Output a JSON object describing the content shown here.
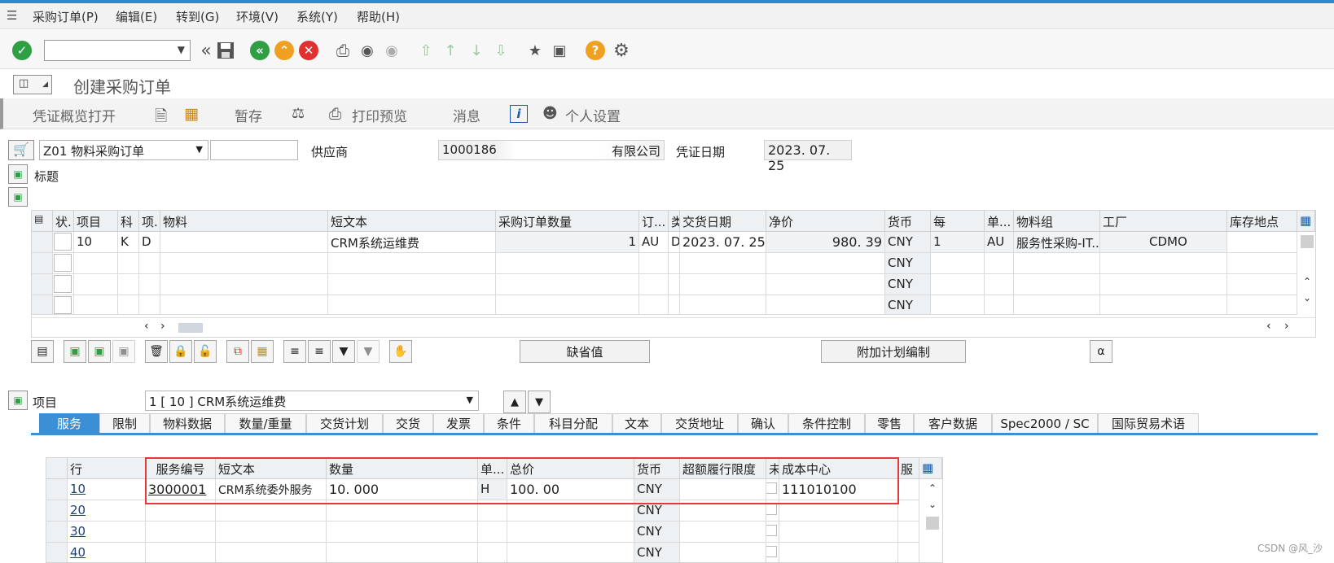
{
  "menu": {
    "items": [
      "采购订单(P)",
      "编辑(E)",
      "转到(G)",
      "环境(V)",
      "系统(Y)",
      "帮助(H)"
    ]
  },
  "toolbar": {
    "command_value": ""
  },
  "page_title": "创建采购订单",
  "app_toolbar": {
    "doc_overview": "凭证概览打开",
    "hold": "暂存",
    "print_preview": "打印预览",
    "messages": "消息",
    "personal_settings": "个人设置"
  },
  "header": {
    "order_type": "Z01 物料采购订单",
    "order_number": "",
    "vendor_label": "供应商",
    "vendor_code": "1000186",
    "vendor_name": "有限公司",
    "doc_date_label": "凭证日期",
    "doc_date": "2023. 07. 25",
    "header_label": "标题"
  },
  "item_grid": {
    "columns": [
      "状.",
      "项目",
      "科",
      "项.",
      "物料",
      "短文本",
      "采购订单数量",
      "订...",
      "类",
      "交货日期",
      "净价",
      "货币",
      "每",
      "单...",
      "物料组",
      "工厂",
      "库存地点"
    ],
    "rows": [
      {
        "item": "10",
        "acct": "K",
        "cat": "D",
        "material": "",
        "short_text": "CRM系统运维费",
        "qty": "1",
        "uom": "AU",
        "dtype": "D",
        "delivery_date": "2023. 07. 25",
        "net_price": "980. 39",
        "currency": "CNY",
        "per": "1",
        "unit": "AU",
        "mat_group": "服务性采购-IT...",
        "plant": "CDMO",
        "sloc": ""
      },
      {
        "item": "",
        "acct": "",
        "cat": "",
        "material": "",
        "short_text": "",
        "qty": "",
        "uom": "",
        "dtype": "",
        "delivery_date": "",
        "net_price": "",
        "currency": "CNY",
        "per": "",
        "unit": "",
        "mat_group": "",
        "plant": "",
        "sloc": ""
      },
      {
        "item": "",
        "acct": "",
        "cat": "",
        "material": "",
        "short_text": "",
        "qty": "",
        "uom": "",
        "dtype": "",
        "delivery_date": "",
        "net_price": "",
        "currency": "CNY",
        "per": "",
        "unit": "",
        "mat_group": "",
        "plant": "",
        "sloc": ""
      },
      {
        "item": "",
        "acct": "",
        "cat": "",
        "material": "",
        "short_text": "",
        "qty": "",
        "uom": "",
        "dtype": "",
        "delivery_date": "",
        "net_price": "",
        "currency": "CNY",
        "per": "",
        "unit": "",
        "mat_group": "",
        "plant": "",
        "sloc": ""
      }
    ]
  },
  "grid_buttons": {
    "default_values": "缺省值",
    "add_planning": "附加计划编制"
  },
  "item_detail": {
    "label": "项目",
    "selected": "1 [ 10 ] CRM系统运维费",
    "tabs": [
      "服务",
      "限制",
      "物料数据",
      "数量/重量",
      "交货计划",
      "交货",
      "发票",
      "条件",
      "科目分配",
      "文本",
      "交货地址",
      "确认",
      "条件控制",
      "零售",
      "客户数据",
      "Spec2000 / SC",
      "国际贸易术语"
    ]
  },
  "service_grid": {
    "columns": [
      "行",
      "服务编号",
      "短文本",
      "数量",
      "单...",
      "总价",
      "货币",
      "超额履行限度",
      "未",
      "成本中心",
      "服"
    ],
    "rows": [
      {
        "line": "10",
        "service": "3000001",
        "short_text": "CRM系统委外服务",
        "qty": "10. 000",
        "unit": "H",
        "gross": "100. 00",
        "currency": "CNY",
        "overfulfil": "",
        "cost_center": "111010100"
      },
      {
        "line": "20",
        "service": "",
        "short_text": "",
        "qty": "",
        "unit": "",
        "gross": "",
        "currency": "CNY",
        "overfulfil": "",
        "cost_center": ""
      },
      {
        "line": "30",
        "service": "",
        "short_text": "",
        "qty": "",
        "unit": "",
        "gross": "",
        "currency": "CNY",
        "overfulfil": "",
        "cost_center": ""
      },
      {
        "line": "40",
        "service": "",
        "short_text": "",
        "qty": "",
        "unit": "",
        "gross": "",
        "currency": "CNY",
        "overfulfil": "",
        "cost_center": ""
      }
    ]
  },
  "watermark": "CSDN @风_沙",
  "colors": {
    "accent": "#3b8fd4",
    "highlight": "#e23a3a"
  }
}
